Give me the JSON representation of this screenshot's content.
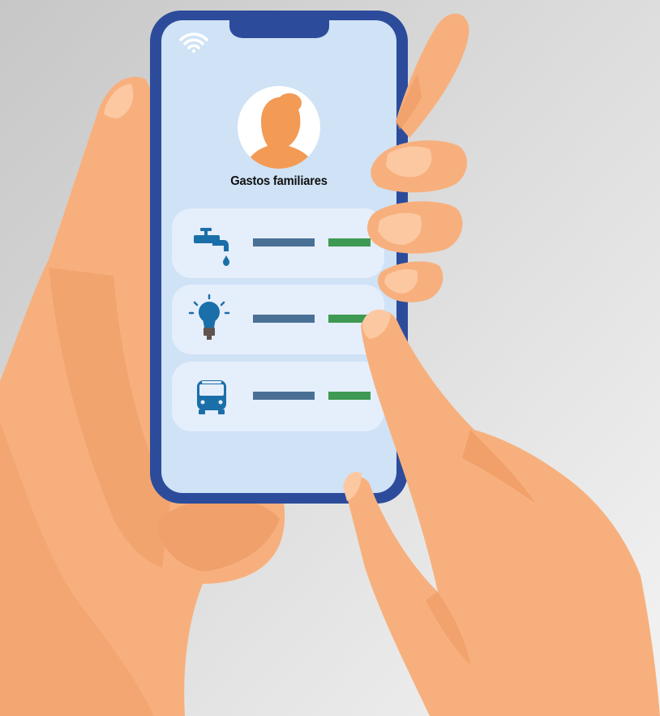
{
  "app": {
    "title": "Gastos familiares"
  },
  "status_bar": {
    "icon": "wifi-icon"
  },
  "profile": {
    "icon": "person-avatar-icon"
  },
  "expenses": [
    {
      "icon": "water-tap-icon",
      "label_bar_color": "#4a6f95",
      "value_bar_color": "#3e9a52"
    },
    {
      "icon": "light-bulb-icon",
      "label_bar_color": "#4a6f95",
      "value_bar_color": "#3e9a52"
    },
    {
      "icon": "bus-icon",
      "label_bar_color": "#4a6f95",
      "value_bar_color": "#3e9a52"
    }
  ],
  "colors": {
    "background_top": "#c9c9c9",
    "background_bottom": "#f0f0f0",
    "phone_frame": "#2c4c9b",
    "screen": "#cfe2f6",
    "card": "#e5eefb",
    "skin": "#f7b07d",
    "skin_shadow": "#ee9a63",
    "nail": "#fcc8a1",
    "icon_blue": "#1b6fa8",
    "avatar_orange": "#f39a55"
  }
}
